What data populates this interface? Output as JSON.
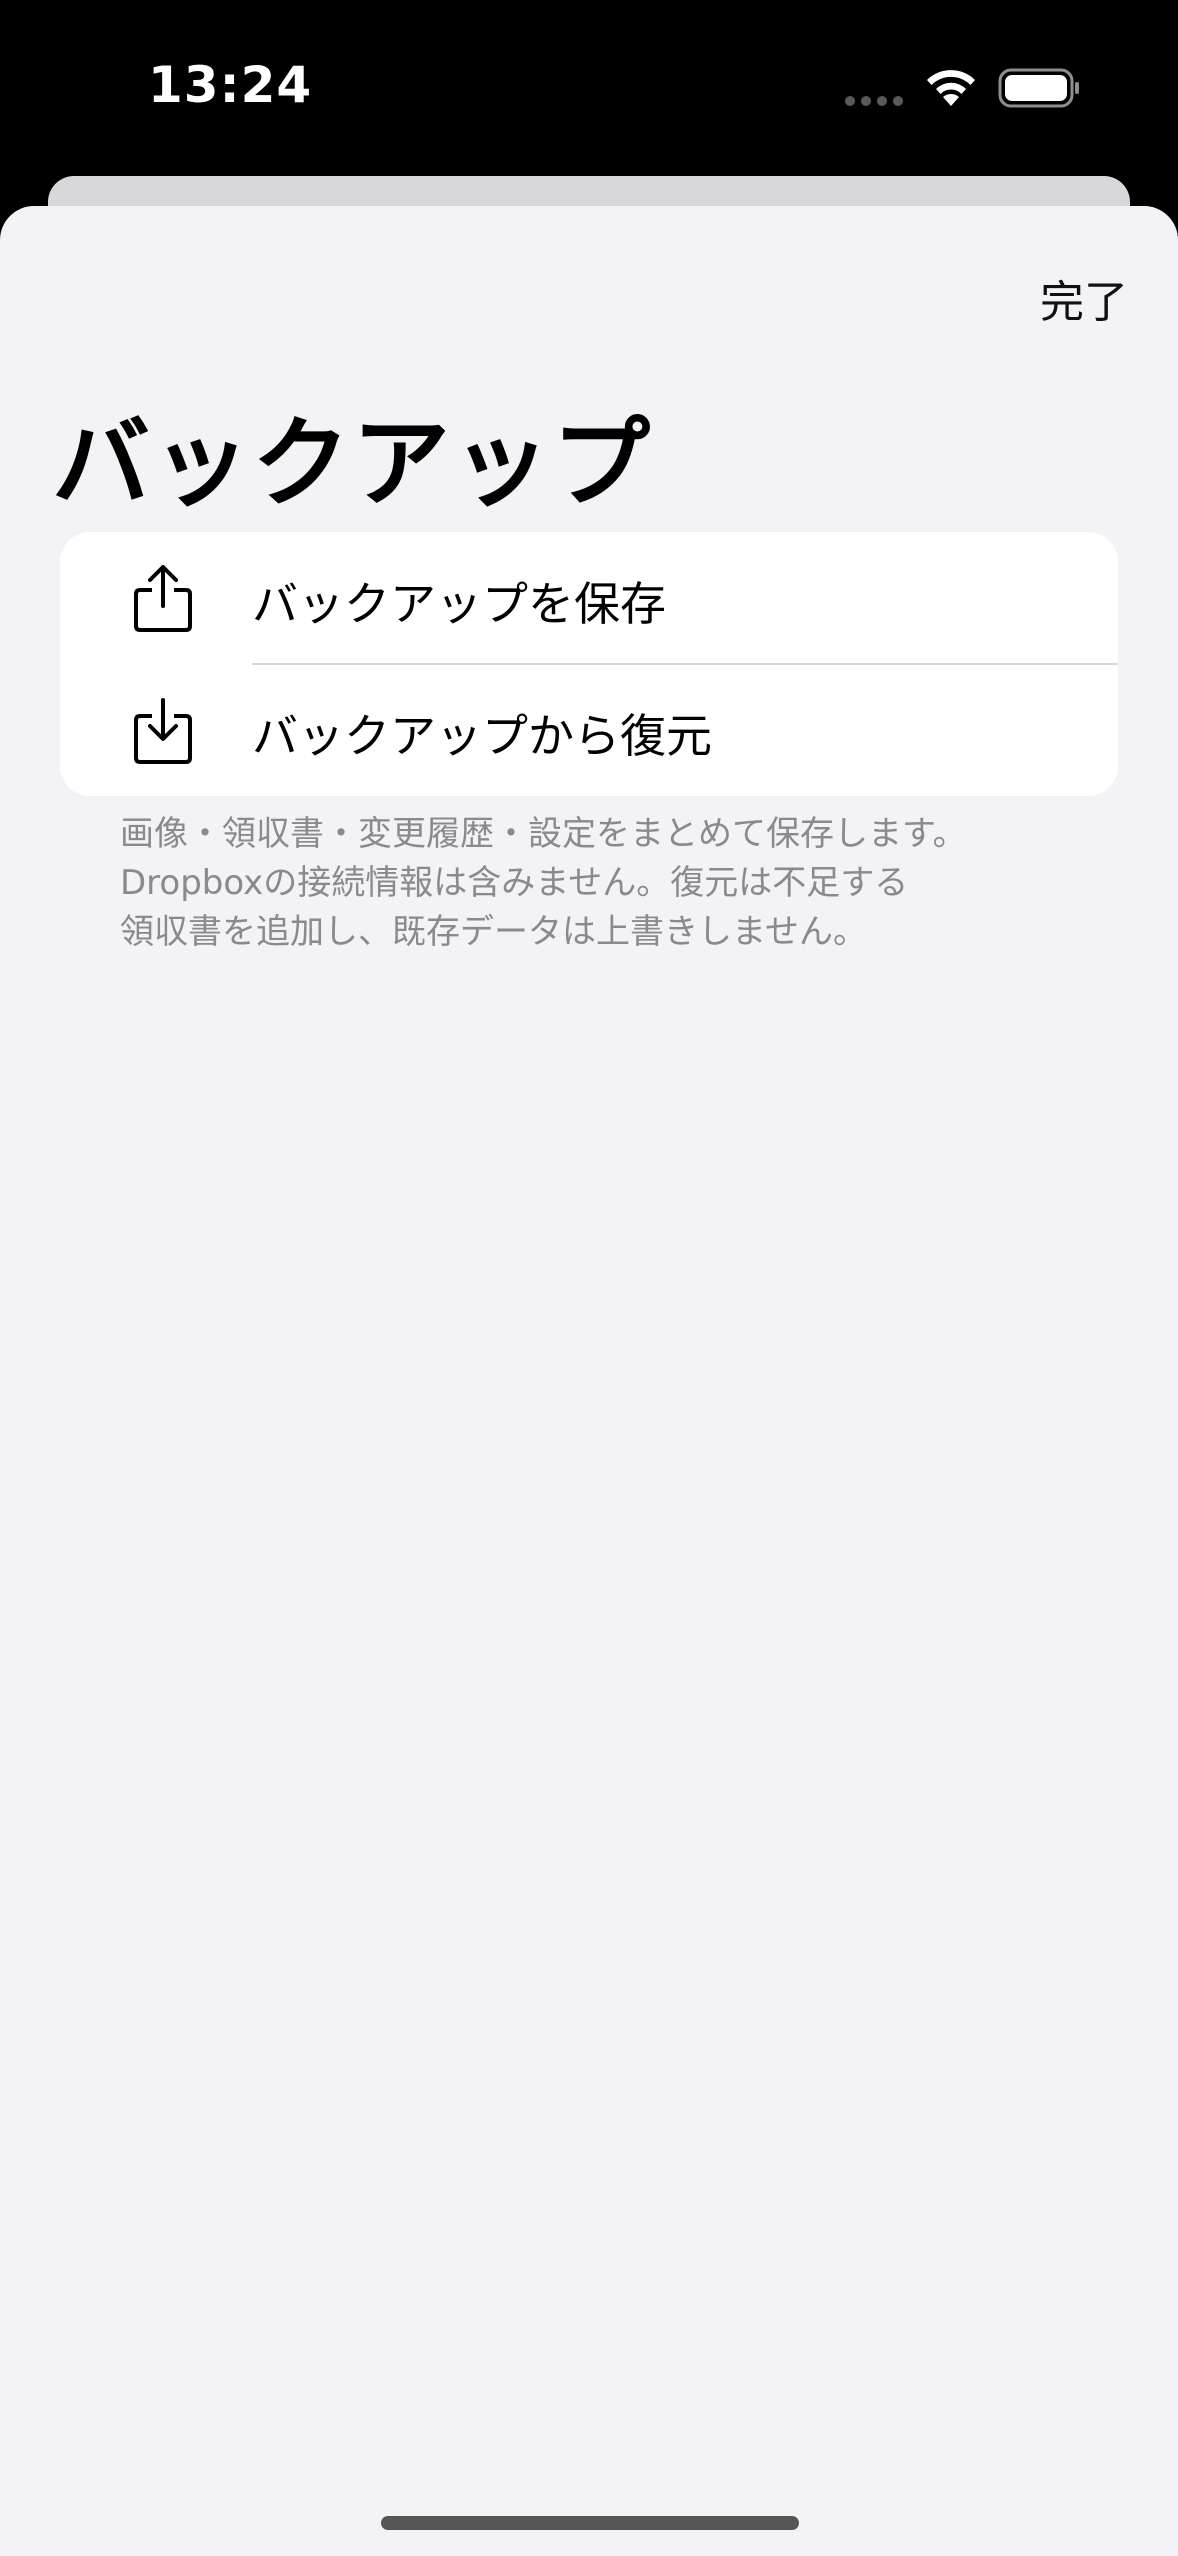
{
  "status_bar": {
    "time": "13:24",
    "icons": [
      "signal-dots-icon",
      "wifi-icon",
      "battery-icon"
    ]
  },
  "navigation": {
    "done_label": "完了"
  },
  "page": {
    "title": "バックアップ"
  },
  "actions": [
    {
      "label": "バックアップを保存",
      "icon": "share-upload-icon"
    },
    {
      "label": "バックアップから復元",
      "icon": "download-tray-icon"
    }
  ],
  "footer": {
    "lines": [
      "画像・領収書・変更履歴・設定をまとめて保存します。",
      "Dropboxの接続情報は含みません。復元は不足する",
      "領収書を追加し、既存データは上書きしません。"
    ]
  },
  "colors": {
    "sheet_background": "#f2f2f7",
    "card_background": "#ffffff",
    "secondary_text": "#8a8a8e",
    "separator": "#d6d6da"
  }
}
